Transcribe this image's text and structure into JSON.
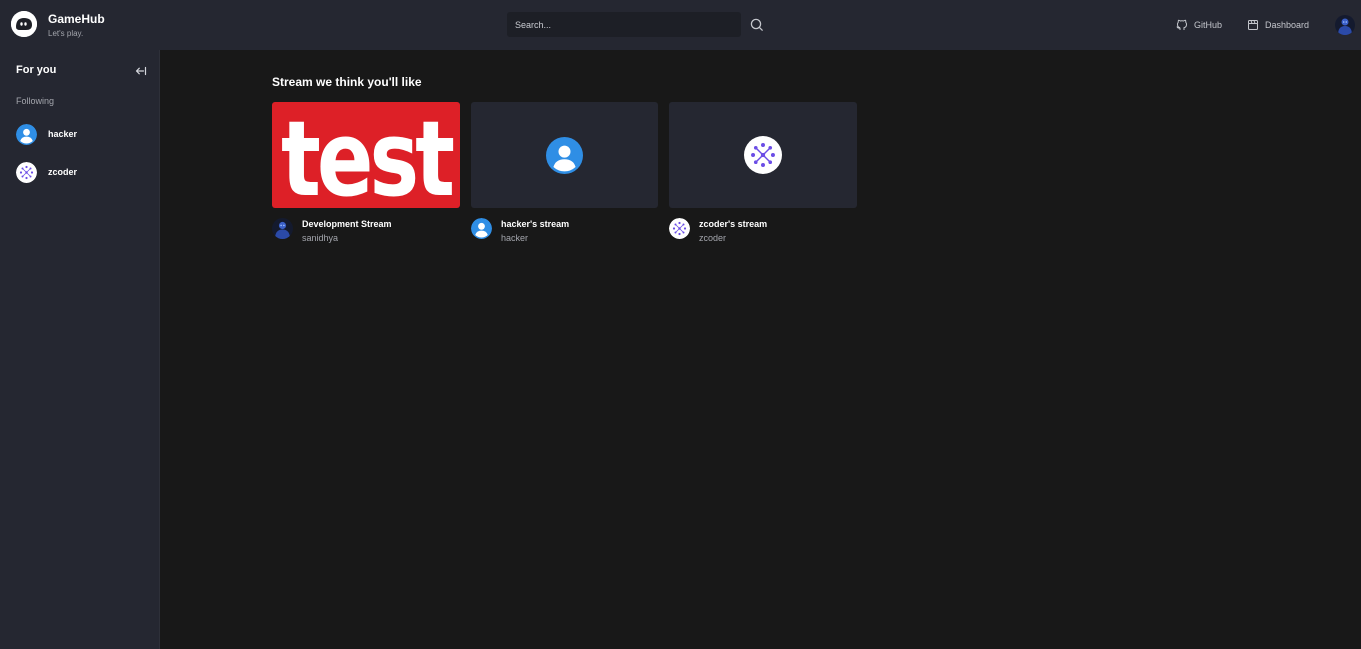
{
  "app": {
    "title": "GameHub",
    "tagline": "Let's play."
  },
  "search": {
    "placeholder": "Search...",
    "value": ""
  },
  "nav": {
    "github_label": "GitHub",
    "dashboard_label": "Dashboard"
  },
  "sidebar": {
    "title": "For you",
    "following_label": "Following",
    "users": [
      {
        "name": "hacker",
        "avatar": "default-person-avatar"
      },
      {
        "name": "zcoder",
        "avatar": "pattern-avatar"
      }
    ]
  },
  "main": {
    "section_title": "Stream we think you'll like",
    "streams": [
      {
        "title": "Development Stream",
        "username": "sanidhya",
        "thumbnail_text": "test",
        "thumbnail_color": "#dd2027"
      },
      {
        "title": "hacker's stream",
        "username": "hacker"
      },
      {
        "title": "zcoder's stream",
        "username": "zcoder"
      }
    ]
  },
  "colors": {
    "topbar": "#252731",
    "background": "#181818",
    "avatar_blue": "#2f8ee5",
    "accent_purple": "#6b4de6"
  }
}
